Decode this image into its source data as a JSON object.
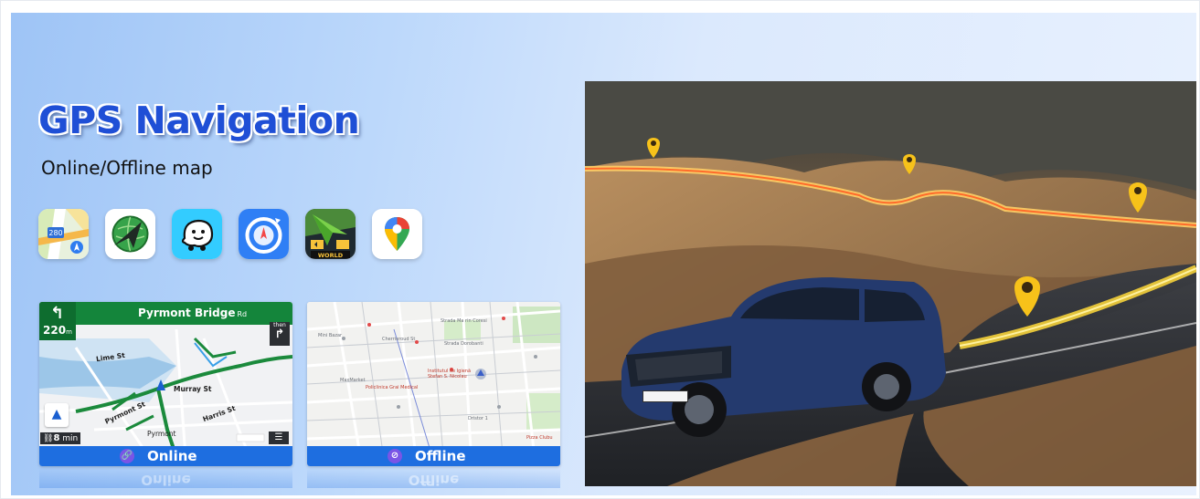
{
  "header": {
    "title": "GPS Navigation",
    "subtitle": "Online/Offline map"
  },
  "apps": [
    {
      "name": "apple-maps-icon"
    },
    {
      "name": "navitel-icon"
    },
    {
      "name": "waze-icon"
    },
    {
      "name": "navi-compass-icon"
    },
    {
      "name": "sygic-world-icon",
      "label": "WORLD"
    },
    {
      "name": "google-maps-icon"
    }
  ],
  "online_card": {
    "turn_distance": "220",
    "turn_unit": "m",
    "road_name": "Pyrmont Bridge",
    "road_suffix": "Rd",
    "then_label": "then",
    "streets": [
      "Lime St",
      "Murray St",
      "Harris St",
      "Pyrmont",
      "Pyrmont St"
    ],
    "eta_value": "8",
    "eta_unit": "min",
    "mode_label": "Online",
    "reflection_label": "Online"
  },
  "offline_card": {
    "mode_label": "Offline",
    "places": [
      "Strada Ma rin Coresi",
      "Strada Dorobanti",
      "Institutul de Igienă Stefan S. Nicolau",
      "Policlinica Grai Medical",
      "Dristor 1",
      "Pizza Clubu",
      "Mini Bazar",
      "MaxMarket",
      "Cherrieroud St"
    ]
  },
  "colors": {
    "title": "#1f4fd6",
    "mode_bar": "#1e6ee0",
    "nav_green": "#14853b",
    "pin_yellow": "#f7c21a"
  }
}
